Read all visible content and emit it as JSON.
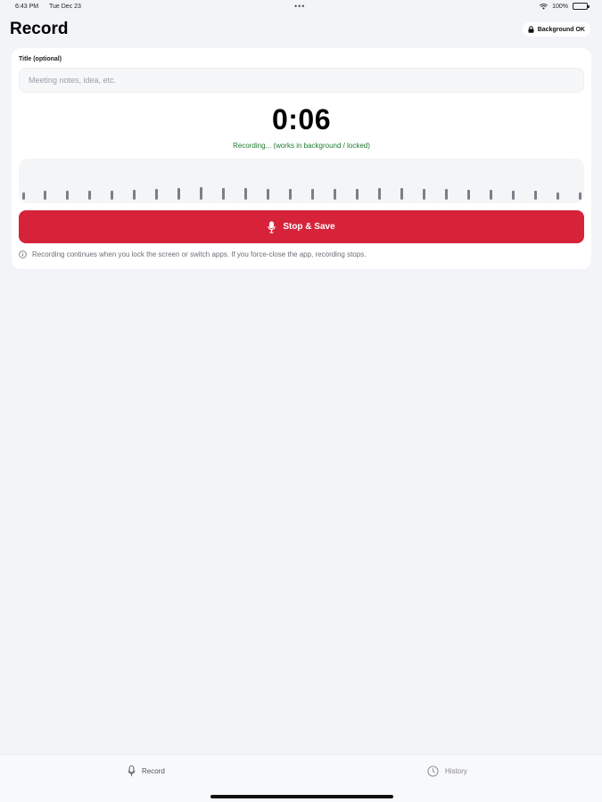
{
  "status_bar": {
    "time": "6:43 PM",
    "date": "Tue Dec 23",
    "battery": "100%"
  },
  "header": {
    "title": "Record",
    "badge_label": "Background OK"
  },
  "form": {
    "title_label": "Title (optional)",
    "title_placeholder": "Meeting notes, idea, etc.",
    "title_value": ""
  },
  "recorder": {
    "timer": "0:06",
    "status": "Recording... (works in background / locked)",
    "stop_button_label": "Stop & Save",
    "info_note": "Recording continues when you lock the screen or switch apps. If you force-close the app, recording stops.",
    "waveform_levels": [
      0.35,
      0.4,
      0.4,
      0.4,
      0.4,
      0.45,
      0.5,
      0.55,
      0.6,
      0.55,
      0.55,
      0.5,
      0.5,
      0.5,
      0.5,
      0.5,
      0.55,
      0.55,
      0.5,
      0.5,
      0.45,
      0.45,
      0.4,
      0.4,
      0.35,
      0.35
    ],
    "accent_color": "#d6233a",
    "status_color": "#1f7a2e"
  },
  "tab_bar": {
    "tabs": [
      {
        "label": "Record",
        "icon": "mic-icon"
      },
      {
        "label": "History",
        "icon": "clock-icon"
      }
    ]
  }
}
